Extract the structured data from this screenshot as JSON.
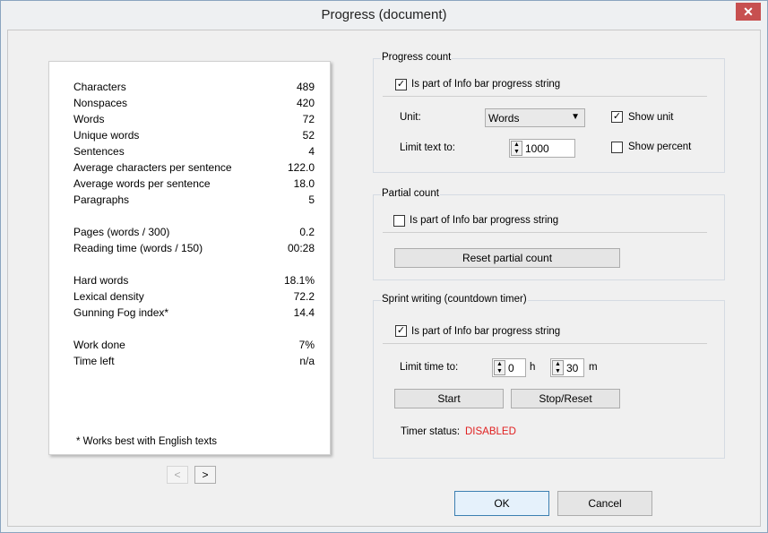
{
  "window": {
    "title": "Progress (document)",
    "close_label": "✕"
  },
  "stats": {
    "rows": [
      {
        "label": "Characters",
        "value": "489"
      },
      {
        "label": "Nonspaces",
        "value": "420"
      },
      {
        "label": "Words",
        "value": "72"
      },
      {
        "label": "Unique words",
        "value": "52"
      },
      {
        "label": "Sentences",
        "value": "4"
      },
      {
        "label": "Average characters per sentence",
        "value": "122.0"
      },
      {
        "label": "Average words per sentence",
        "value": "18.0"
      },
      {
        "label": "Paragraphs",
        "value": "5"
      },
      {
        "label": "Pages (words / 300)",
        "value": "0.2"
      },
      {
        "label": "Reading time (words / 150)",
        "value": "00:28"
      },
      {
        "label": "Hard words",
        "value": "18.1%"
      },
      {
        "label": "Lexical density",
        "value": "72.2"
      },
      {
        "label": "Gunning Fog index*",
        "value": "14.4"
      },
      {
        "label": "Work done",
        "value": "7%"
      },
      {
        "label": "Time left",
        "value": "n/a"
      }
    ],
    "footnote": "* Works best with English texts",
    "prev_label": "<",
    "next_label": ">"
  },
  "progress_count": {
    "title": "Progress count",
    "infobar_label": "Is part of Info bar progress string",
    "infobar_checked": true,
    "unit_label": "Unit:",
    "unit_value": "Words",
    "show_unit_label": "Show unit",
    "show_unit_checked": true,
    "limit_label": "Limit text to:",
    "limit_value": "1000",
    "show_percent_label": "Show percent",
    "show_percent_checked": false
  },
  "partial_count": {
    "title": "Partial count",
    "infobar_label": "Is part of Info bar progress string",
    "infobar_checked": false,
    "reset_label": "Reset partial count"
  },
  "sprint": {
    "title": "Sprint writing (countdown timer)",
    "infobar_label": "Is part of Info bar progress string",
    "infobar_checked": true,
    "limit_label": "Limit time to:",
    "hours_value": "0",
    "hours_unit": "h",
    "minutes_value": "30",
    "minutes_unit": "m",
    "start_label": "Start",
    "stop_label": "Stop/Reset",
    "status_label": "Timer status:",
    "status_value": "DISABLED",
    "status_color": "#e02020"
  },
  "footer": {
    "ok_label": "OK",
    "cancel_label": "Cancel"
  }
}
